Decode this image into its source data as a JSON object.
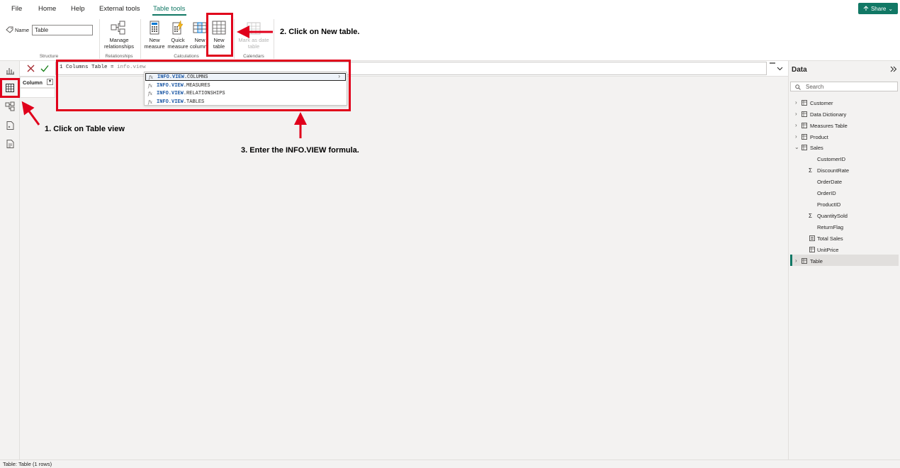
{
  "menu": {
    "items": [
      "File",
      "Home",
      "Help",
      "External tools",
      "Table tools"
    ],
    "active": "Table tools",
    "share_label": "Share"
  },
  "ribbon": {
    "name_label": "Name",
    "name_value": "Table",
    "structure_label": "Structure",
    "manage_rel_line1": "Manage",
    "manage_rel_line2": "relationships",
    "relationships_label": "Relationships",
    "new_measure_line1": "New",
    "new_measure_line2": "measure",
    "quick_measure_line1": "Quick",
    "quick_measure_line2": "measure",
    "new_column_line1": "New",
    "new_column_line2": "column",
    "new_table_line1": "New",
    "new_table_line2": "table",
    "calculations_label": "Calculations",
    "mark_date_line1": "Mark as date",
    "mark_date_line2": "table",
    "calendars_label": "Calendars"
  },
  "formula": {
    "line_number": "1",
    "text": "Columns Table = ",
    "typed": "info.view"
  },
  "grid": {
    "column_header": "Column"
  },
  "autocomplete": {
    "items": [
      {
        "prefix": "INFO.VIEW",
        "rest": ".COLUMNS"
      },
      {
        "prefix": "INFO.VIEW",
        "rest": ".MEASURES"
      },
      {
        "prefix": "INFO.VIEW",
        "rest": ".RELATIONSHIPS"
      },
      {
        "prefix": "INFO.VIEW",
        "rest": ".TABLES"
      }
    ],
    "fx": "fx"
  },
  "data_pane": {
    "title": "Data",
    "search_placeholder": "Search",
    "tables": [
      "Customer",
      "Data Dictionary",
      "Measures Table",
      "Product",
      "Sales"
    ],
    "sales_fields": [
      "CustomerID",
      "DiscountRate",
      "OrderDate",
      "OrderID",
      "ProductID",
      "QuantitySold",
      "ReturnFlag",
      "Total Sales",
      "UnitPrice"
    ],
    "last_table": "Table"
  },
  "status": {
    "text": "Table: Table (1 rows)"
  },
  "annotations": {
    "step1": "1. Click on Table view",
    "step2": "2. Click on New table.",
    "step3": "3. Enter the INFO.VIEW formula."
  },
  "colors": {
    "accent": "#117865",
    "annotation_red": "#e0001b"
  }
}
